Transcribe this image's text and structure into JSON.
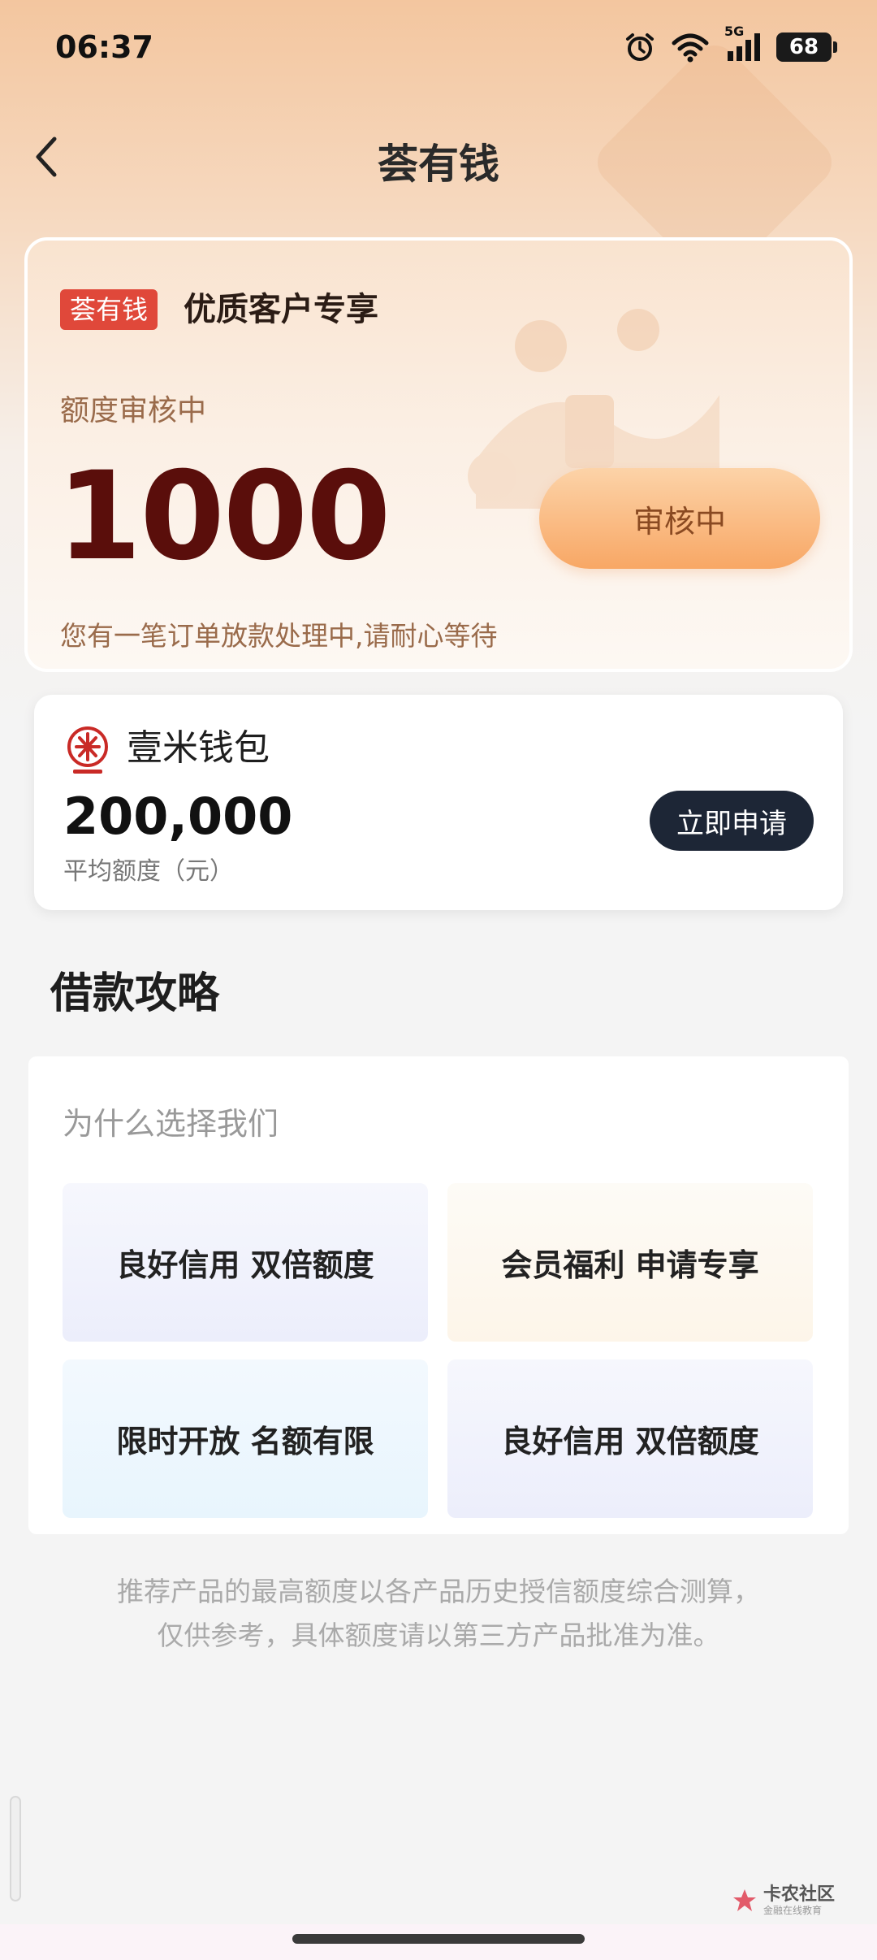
{
  "status_bar": {
    "time": "06:37",
    "network": "5G",
    "battery": "68"
  },
  "header": {
    "title": "荟有钱"
  },
  "hero": {
    "brand_tag": "荟有钱",
    "exclusive_label": "优质客户专享",
    "status_label": "额度审核中",
    "amount": "1000",
    "review_button": "审核中",
    "pending_note": "您有一笔订单放款处理中,请耐心等待"
  },
  "product": {
    "name": "壹米钱包",
    "amount": "200,000",
    "unit_label": "平均额度（元）",
    "apply_button": "立即申请"
  },
  "guide": {
    "section_title": "借款攻略",
    "why_title": "为什么选择我们",
    "features": [
      "良好信用 双倍额度",
      "会员福利 申请专享",
      "限时开放 名额有限",
      "良好信用 双倍额度"
    ]
  },
  "disclaimer": {
    "line1": "推荐产品的最高额度以各产品历史授信额度综合测算，",
    "line2": "仅供参考，具体额度请以第三方产品批准为准。"
  },
  "watermark": {
    "main": "卡农社区",
    "sub": "金融在线教育"
  },
  "colors": {
    "accent_red": "#e0483a",
    "amount_dark_red": "#5a0e0b",
    "review_button_orange": "#f8a765",
    "apply_button_navy": "#1d2636"
  }
}
